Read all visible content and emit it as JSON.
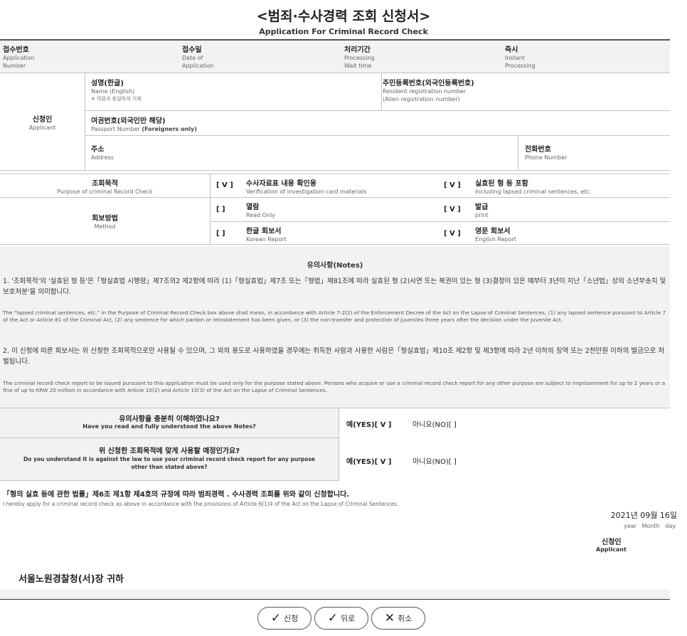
{
  "form": {
    "title": "<범죄·수사경력 조회 신청서>",
    "subtitle": "Application For Criminal Record Check"
  },
  "header_row": {
    "receipt_no": {
      "ko": "접수번호",
      "en1": "Application",
      "en2": "Number"
    },
    "receipt_date": {
      "ko": "접수일",
      "en1": "Date of",
      "en2": "Application"
    },
    "processing": {
      "ko": "처리기간",
      "en1": "Processing",
      "en2": "Wait time"
    },
    "instant": {
      "ko": "즉시",
      "en1": "Instant",
      "en2": "Processing"
    }
  },
  "applicant": {
    "section_ko": "신청인",
    "section_en": "Applicant",
    "name_ko": "성명(한글)",
    "name_en": "Name (English)",
    "name_note": "※ 여권과 동일하게 기재",
    "rrn_ko": "주민등록번호(외국인등록번호)",
    "rrn_en1": "Resident registration number",
    "rrn_en2": "(Alien registration number)",
    "passport_ko": "여권번호(외국인만 해당)",
    "passport_en_a": "Passport Number ",
    "passport_en_b": "(Foreigners only)",
    "address_ko": "주소",
    "address_en": "Address",
    "phone_ko": "전화번호",
    "phone_en": "Phone Number"
  },
  "purpose": {
    "label_ko": "조회목적",
    "label_en": "Purpose of criminal Record Check",
    "opt1_check": "[ V ]",
    "opt1_ko": "수사자료표 내용 확인용",
    "opt1_en": "Verification of investigation card materials",
    "opt2_check": "[ V ]",
    "opt2_ko": "실효된 형 등 포함",
    "opt2_en": "Including lapsed criminal sentences, etc."
  },
  "method": {
    "label_ko": "회보방법",
    "label_en": "Method",
    "opt1_check": "[  ]",
    "opt1_ko": "열람",
    "opt1_en": "Read Only",
    "opt2_check": "[ V ]",
    "opt2_ko": "발급",
    "opt2_en": "print",
    "opt3_check": "[  ]",
    "opt3_ko": "한글 회보서",
    "opt3_en": "Korean Report",
    "opt4_check": "[ V ]",
    "opt4_ko": "영문 회보서",
    "opt4_en": "English Report"
  },
  "notes": {
    "heading": "유의사항(Notes)",
    "n1_ko": "1. '조회목적'의 '실효된 형 등'은「형실효법 시행령」제7조의2 제2항에 따라 (1)「형실효법」제7조 또는「형법」제81조에 따라 실효된 형 (2)사면 또는 복권이 있는 형 (3)결정이 있은 때부터 3년이 지난「소년법」상의 소년부송치 및 보호처분'을 의미합니다.",
    "n1_en": "The \"lapsed criminal sentences, etc.\" in the Purpose of Criminal Record Check box above shall mean, in accordance with Article 7-2(2) of the Enforcement Decree of the Act on the Lapse of Criminal Sentences, (1) any lapsed sentence pursuant to Article 7 of the Act or Article 81 of the Criminal Act, (2) any sentence for which pardon or reinstatement has been given, or (3) the non-transfer and protection of juveniles three years after the decision under the Juvenile Act.",
    "n2_ko": "2. 이 신청에 따른 회보서는 위 신청한 조회목적으로만 사용될 수 있으며, 그 외의 용도로 사용하였을 경우에는 취득한 사람과 사용한 사람은「형실효법」제10조 제2항 및 제3항에 따라 2년 이하의 징역 또는 2천만원 이하의 벌금으로 처벌됩니다.",
    "n2_en": "The criminal record check report to be issued pursuant to this application must be used only for the purpose stated above. Persons who acquire or use a criminal record check report for any other purpose are subject to imprisonment for up to 2 years or a fine of up to KRW 20 million in accordance with Article 10(2) and Article 10(3) of the Act on the Lapse of Criminal Sentences."
  },
  "questions": {
    "q1_ko": "유의사항을 충분히 이해하였나요?",
    "q1_en": "Have you read and fully understood the above Notes?",
    "q1_yes": "예(YES)[ V ]",
    "q1_no": "아니요(NO)[  ]",
    "q2_ko": "위 신청한 조회목적에 맞게 사용할 예정인가요?",
    "q2_en1": "Do you understand it is against the law to use your criminal record check report for any purpose",
    "q2_en2": "other than stated above?",
    "q2_yes": "예(YES)[ V ]",
    "q2_no": "아니요(NO)[  ]"
  },
  "declaration": {
    "ko": "「형의 실효 등에 관한 법률」제6조 제1항 제4호의 규정에 따라 범죄경력 . 수사경력 조회를 위와 같이 신청합니다.",
    "en": "I hereby apply for a criminal record check as above in accordance with the provisions of Article 6(1)4 of the Act on the Lapse of Criminal Sentences.",
    "date": "2021년 09월 16일",
    "date_en": "year   Month   day",
    "applicant_ko": "신청인",
    "applicant_en": "Applicant",
    "addressee": "서울노원경찰청(서)장 귀하"
  },
  "buttons": {
    "apply": "신청",
    "back": "뒤로",
    "cancel": "취소"
  }
}
